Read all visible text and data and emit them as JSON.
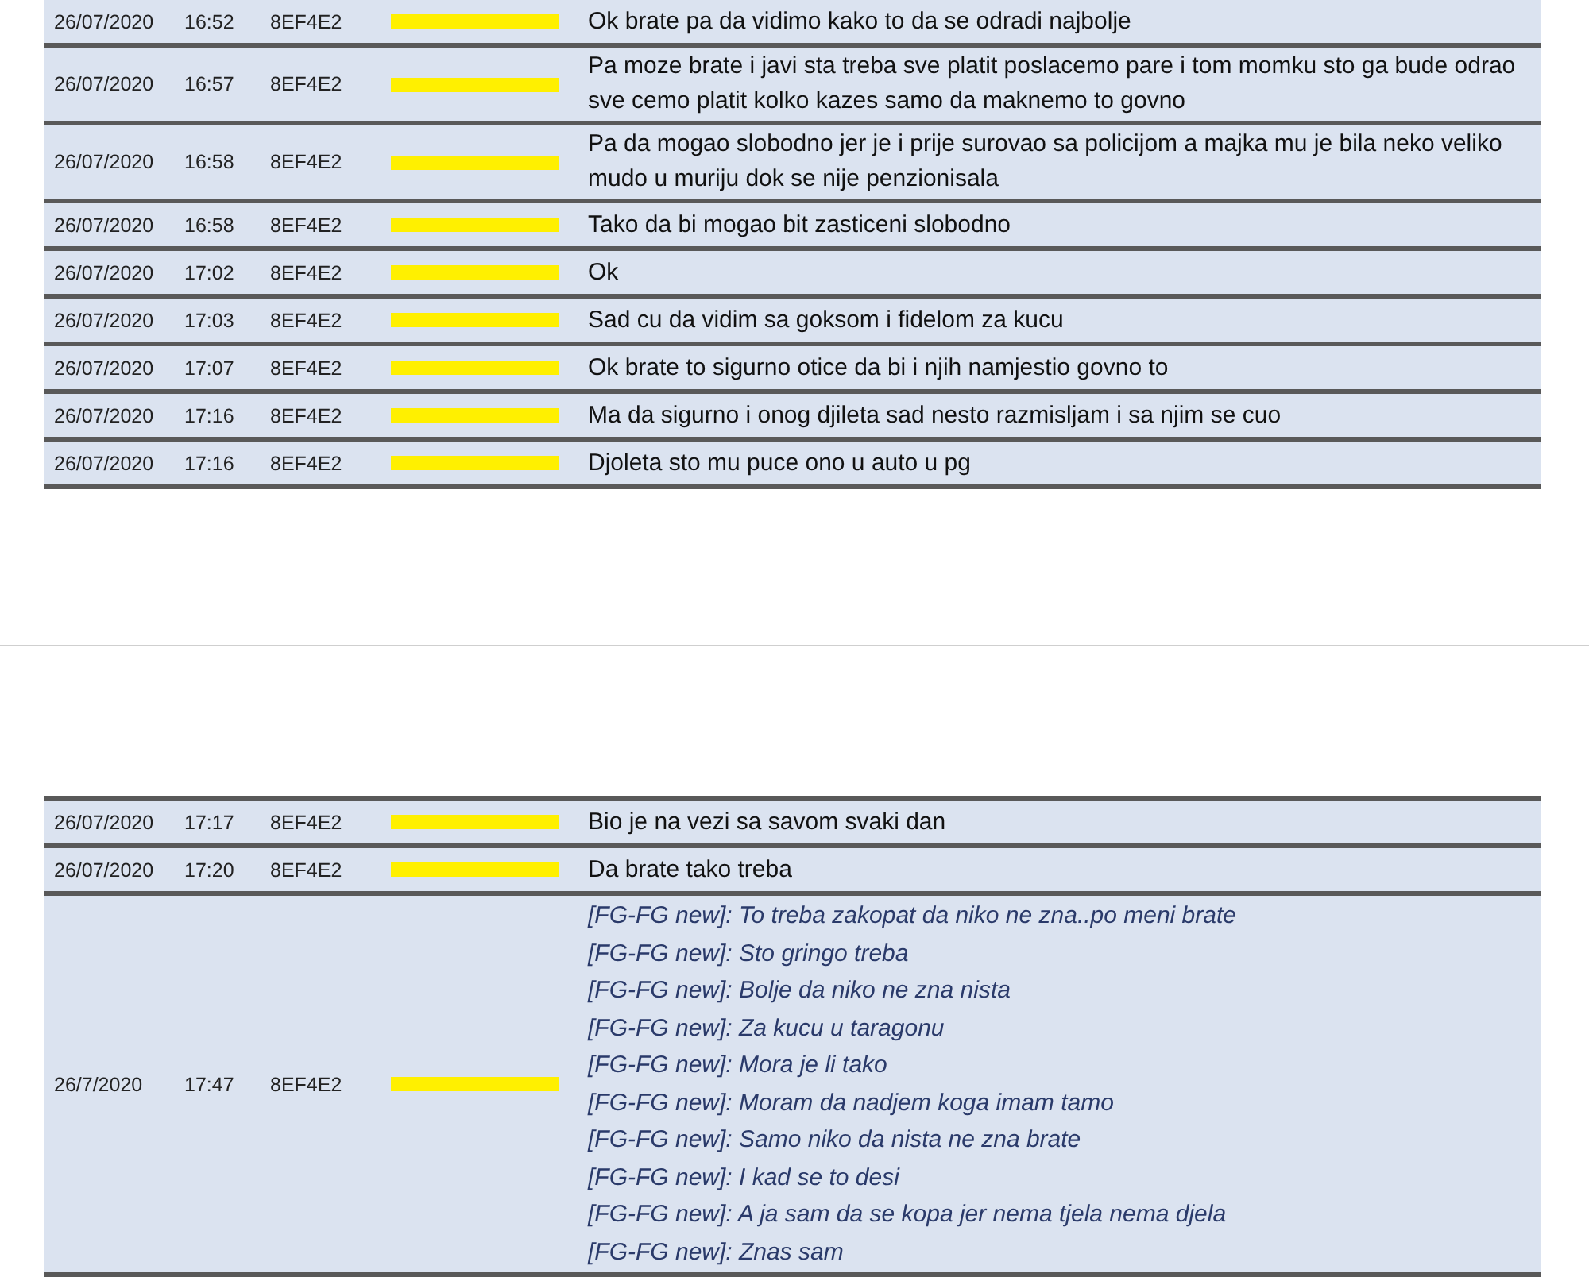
{
  "pages": [
    {
      "rows": [
        {
          "date": "26/07/2020",
          "time": "16:52",
          "device": "8EF4E2",
          "kind": "plain",
          "lines": [
            "Ok brate pa da vidimo kako to da se odradi najbolje"
          ]
        },
        {
          "date": "26/07/2020",
          "time": "16:57",
          "device": "8EF4E2",
          "kind": "plain",
          "lines": [
            "Pa moze brate i javi sta treba sve platit poslacemo pare i tom momku sto ga bude odrao sve cemo platit kolko kazes samo da maknemo to govno"
          ]
        },
        {
          "date": "26/07/2020",
          "time": "16:58",
          "device": "8EF4E2",
          "kind": "plain",
          "lines": [
            "Pa da mogao slobodno jer je i prije surovao sa policijom a majka mu je bila neko veliko mudo u muriju dok se nije penzionisala"
          ]
        },
        {
          "date": "26/07/2020",
          "time": "16:58",
          "device": "8EF4E2",
          "kind": "plain",
          "lines": [
            "Tako da bi mogao bit zasticeni slobodno"
          ]
        },
        {
          "date": "26/07/2020",
          "time": "17:02",
          "device": "8EF4E2",
          "kind": "plain",
          "lines": [
            "Ok"
          ]
        },
        {
          "date": "26/07/2020",
          "time": "17:03",
          "device": "8EF4E2",
          "kind": "plain",
          "lines": [
            "Sad cu da vidim sa goksom i fidelom za kucu"
          ]
        },
        {
          "date": "26/07/2020",
          "time": "17:07",
          "device": "8EF4E2",
          "kind": "plain",
          "lines": [
            "Ok brate to sigurno otice da bi i njih namjestio govno to"
          ]
        },
        {
          "date": "26/07/2020",
          "time": "17:16",
          "device": "8EF4E2",
          "kind": "plain",
          "lines": [
            "Ma da sigurno i onog djileta sad nesto razmisljam i sa njim se cuo"
          ]
        },
        {
          "date": "26/07/2020",
          "time": "17:16",
          "device": "8EF4E2",
          "kind": "plain",
          "lines": [
            "Djoleta sto mu puce ono u auto u pg"
          ]
        }
      ]
    },
    {
      "rows": [
        {
          "date": "26/07/2020",
          "time": "17:17",
          "device": "8EF4E2",
          "kind": "plain",
          "lines": [
            "Bio je na vezi sa savom svaki dan"
          ]
        },
        {
          "date": "26/07/2020",
          "time": "17:20",
          "device": "8EF4E2",
          "kind": "plain",
          "lines": [
            "Da brate tako treba"
          ]
        },
        {
          "date": "26/7/2020",
          "time": "17:47",
          "device": "8EF4E2",
          "kind": "forwarded",
          "lines": [
            "[FG-FG new]: To treba zakopat da niko ne zna..po meni brate",
            "[FG-FG new]: Sto gringo treba",
            "[FG-FG new]: Bolje da niko ne zna nista",
            "[FG-FG new]: Za kucu u taragonu",
            "[FG-FG new]: Mora je li tako",
            "[FG-FG new]: Moram da nadjem koga imam tamo",
            "[FG-FG new]: Samo niko da nista ne zna brate",
            "[FG-FG new]: I kad se to desi",
            "[FG-FG new]: A ja sam da se kopa jer nema tjela nema djela",
            "[FG-FG new]: Znas sam"
          ]
        }
      ]
    }
  ]
}
